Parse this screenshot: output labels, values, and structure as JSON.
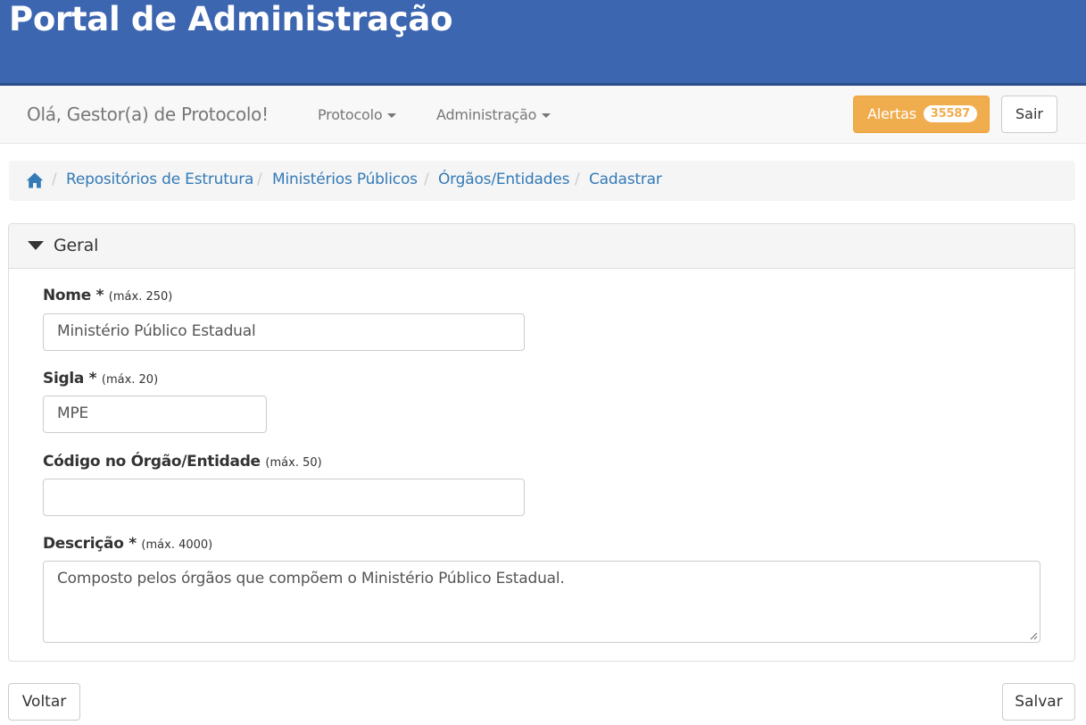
{
  "header": {
    "title": "Portal de Administração"
  },
  "navbar": {
    "greeting": "Olá, Gestor(a) de Protocolo!",
    "menus": [
      {
        "label": "Protocolo"
      },
      {
        "label": "Administração"
      }
    ],
    "alerts": {
      "label": "Alertas",
      "count": "35587"
    },
    "logout_label": "Sair"
  },
  "breadcrumb": {
    "home_icon": "home-icon",
    "separator": "/",
    "items": [
      {
        "label": "Repositórios de Estrutura"
      },
      {
        "label": "Ministérios Públicos"
      },
      {
        "label": "Órgãos/Entidades"
      },
      {
        "label": "Cadastrar"
      }
    ]
  },
  "panel": {
    "title": "Geral",
    "fields": {
      "nome": {
        "label": "Nome *",
        "hint": "(máx. 250)",
        "value": "Ministério Público Estadual"
      },
      "sigla": {
        "label": "Sigla *",
        "hint": "(máx. 20)",
        "value": "MPE"
      },
      "codigo": {
        "label": "Código no Órgão/Entidade",
        "hint": "(máx. 50)",
        "value": ""
      },
      "descricao": {
        "label": "Descrição *",
        "hint": "(máx. 4000)",
        "value": "Composto pelos órgãos que compõem o Ministério Público Estadual."
      }
    }
  },
  "footer": {
    "back_label": "Voltar",
    "save_label": "Salvar"
  },
  "colors": {
    "banner": "#3d66b0",
    "link": "#337ab7",
    "warning": "#f0ad4e"
  }
}
